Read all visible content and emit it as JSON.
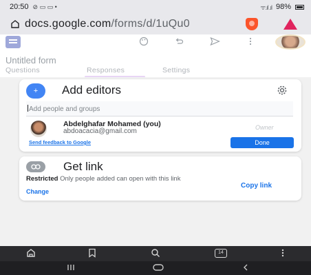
{
  "status": {
    "time": "20:50",
    "left_indicators": "⊘ ▭ ▭ •",
    "signal": "ᯤ.ıl .ıl",
    "battery": "98%"
  },
  "browser": {
    "url_host": "docs.google.com",
    "url_path": "/forms/d/1uQu0"
  },
  "form": {
    "title": "Untitled form",
    "tabs": [
      {
        "label": "Questions"
      },
      {
        "label": "Responses"
      },
      {
        "label": "Settings"
      }
    ]
  },
  "editors_card": {
    "add_icon_glyph": "+",
    "heading": "Add editors",
    "input_placeholder": "Add people and groups",
    "user": {
      "name": "Abdelghafar Mohamed (you)",
      "email": "abdoacacia@gmail.com",
      "role": "Owner"
    },
    "feedback_link": "Send feedback to Google",
    "done_label": "Done"
  },
  "link_card": {
    "heading": "Get link",
    "restricted_bold": "Restricted",
    "restricted_text": " Only people added can open with this link",
    "change_label": "Change",
    "copy_label": "Copy link"
  },
  "browser_nav": {
    "tab_count": "14"
  },
  "colors": {
    "accent_blue": "#1a73e8",
    "brave_orange": "#fb542b",
    "status_bar_bg": "#e8e8ec"
  }
}
